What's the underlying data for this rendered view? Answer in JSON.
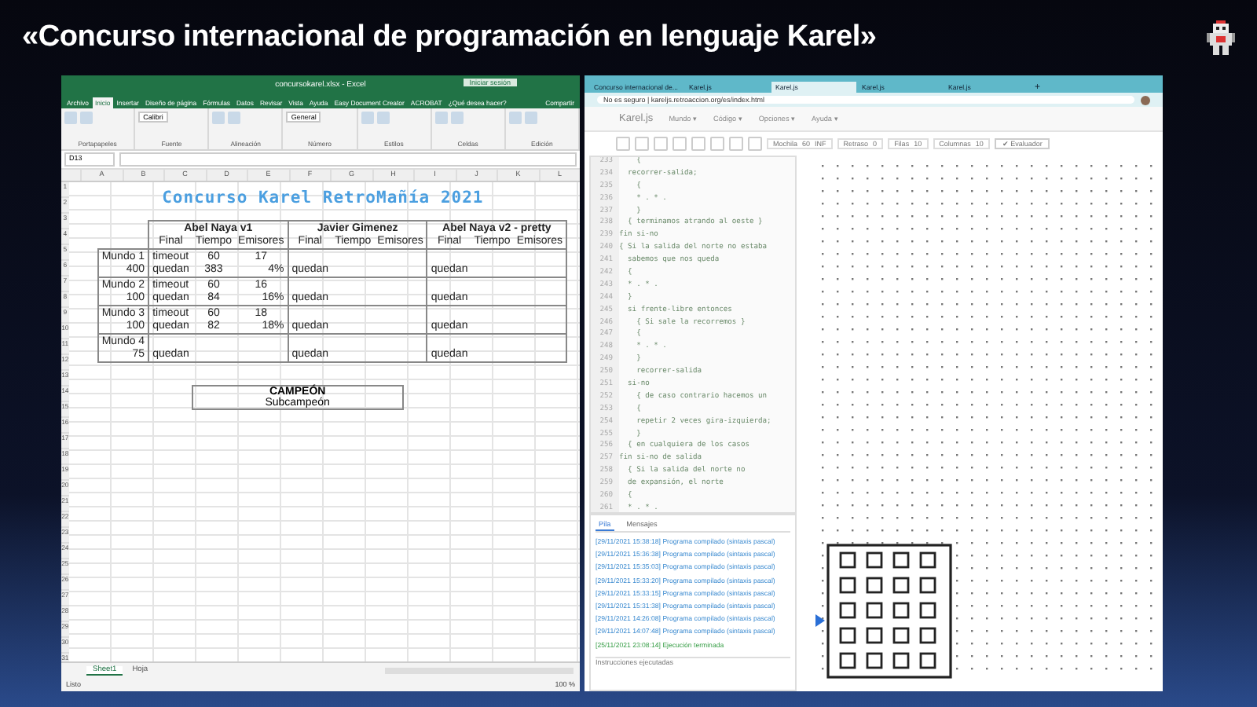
{
  "title": "«Concurso internacional de programación en lenguaje Karel»",
  "excel": {
    "window_title": "concursokarel.xlsx - Excel",
    "signin": "Iniciar sesión",
    "ribbon_tabs": [
      {
        "label": "Archivo",
        "selected": false
      },
      {
        "label": "Inicio",
        "selected": true
      },
      {
        "label": "Insertar",
        "selected": false
      },
      {
        "label": "Diseño de página",
        "selected": false
      },
      {
        "label": "Fórmulas",
        "selected": false
      },
      {
        "label": "Datos",
        "selected": false
      },
      {
        "label": "Revisar",
        "selected": false
      },
      {
        "label": "Vista",
        "selected": false
      },
      {
        "label": "Ayuda",
        "selected": false
      },
      {
        "label": "Easy Document Creator",
        "selected": false
      },
      {
        "label": "ACROBAT",
        "selected": false
      },
      {
        "label": "¿Qué desea hacer?",
        "selected": false
      }
    ],
    "share": "Compartir",
    "ribbon_groups": [
      "Portapapeles",
      "Fuente",
      "Alineación",
      "Número",
      "Estilos",
      "Celdas",
      "Edición"
    ],
    "font_name": "Calibri",
    "number_format": "General",
    "name_box": "D13",
    "columns": [
      "A",
      "B",
      "C",
      "D",
      "E",
      "F",
      "G",
      "H",
      "I",
      "J",
      "K",
      "L"
    ],
    "row_numbers": [
      "1",
      "2",
      "3",
      "4",
      "5",
      "6",
      "7",
      "8",
      "9",
      "10",
      "11",
      "12",
      "13",
      "14",
      "15",
      "16",
      "17",
      "18",
      "19",
      "20",
      "21",
      "22",
      "23",
      "24",
      "25",
      "26",
      "27",
      "28",
      "29",
      "30",
      "31"
    ],
    "sheet_title": "Concurso Karel  RetroMañía 2021",
    "players": [
      {
        "name": "Abel Naya v1",
        "subheaders": [
          "Final",
          "Tiempo",
          "Emisores"
        ]
      },
      {
        "name": "Javier Gimenez",
        "subheaders": [
          "Final",
          "Tiempo",
          "Emisores"
        ]
      },
      {
        "name": "Abel Naya v2 - pretty",
        "subheaders": [
          "Final",
          "Tiempo",
          "Emisores"
        ]
      }
    ],
    "worlds": [
      {
        "name": "Mundo 1",
        "score": "400",
        "results": [
          {
            "row_1": [
              "timeout",
              "60",
              "17"
            ],
            "row_2": [
              "quedan",
              "383",
              "4%"
            ]
          },
          {
            "row_2": [
              "quedan"
            ]
          },
          {
            "row_2": [
              "quedan"
            ]
          }
        ]
      },
      {
        "name": "Mundo 2",
        "score": "100",
        "results": [
          {
            "row_1": [
              "timeout",
              "60",
              "16"
            ],
            "row_2": [
              "quedan",
              "84",
              "16%"
            ]
          },
          {
            "row_2": [
              "quedan"
            ]
          },
          {
            "row_2": [
              "quedan"
            ]
          }
        ]
      },
      {
        "name": "Mundo 3",
        "score": "100",
        "results": [
          {
            "row_1": [
              "timeout",
              "60",
              "18"
            ],
            "row_2": [
              "quedan",
              "82",
              "18%"
            ]
          },
          {
            "row_2": [
              "quedan"
            ]
          },
          {
            "row_2": [
              "quedan"
            ]
          }
        ]
      },
      {
        "name": "Mundo 4",
        "score": "75",
        "results": [
          {
            "row_2": [
              "quedan"
            ]
          },
          {
            "row_2": [
              "quedan"
            ]
          },
          {
            "row_2": [
              "quedan"
            ]
          }
        ]
      }
    ],
    "podium": [
      "CAMPEÓN",
      "Subcampeón"
    ],
    "sheet_tabs": [
      {
        "label": "Sheet1",
        "selected": true
      },
      {
        "label": "Hoja",
        "selected": false
      }
    ],
    "status": "Listo",
    "zoom": "100 %"
  },
  "browser": {
    "tabs": [
      {
        "label": "Concurso internacional de...",
        "selected": false
      },
      {
        "label": "Karel.js",
        "selected": false
      },
      {
        "label": "Karel.js",
        "selected": true
      },
      {
        "label": "Karel.js",
        "selected": false
      },
      {
        "label": "Karel.js",
        "selected": false
      }
    ],
    "new_tab": "+",
    "url": "No es seguro | kareljs.retroaccion.org/es/index.html",
    "brand": "Karel.js",
    "menus": [
      "Mundo ▾",
      "Código ▾",
      "Opciones ▾",
      "Ayuda ▾"
    ],
    "toolbar": {
      "mochila_label": "Mochila",
      "mochila": "60",
      "inf": "INF",
      "delay_label": "Retraso",
      "delay": "0",
      "rows_label": "Filas",
      "rows": "10",
      "cols_label": "Columnas",
      "cols": "10",
      "evaluate": "✔ Evaluador"
    },
    "code_lines": [
      {
        "num": "233",
        "text": "    {"
      },
      {
        "num": "234",
        "text": "  recorrer-salida;"
      },
      {
        "num": "235",
        "text": "    {"
      },
      {
        "num": "236",
        "text": "    * . * ."
      },
      {
        "num": "237",
        "text": "    }"
      },
      {
        "num": "238",
        "text": "  { terminamos atrando al oeste }"
      },
      {
        "num": "239",
        "text": "fin si-no"
      },
      {
        "num": "240",
        "text": "{ Si la salida del norte no estaba"
      },
      {
        "num": "241",
        "text": "  sabemos que nos queda"
      },
      {
        "num": "242",
        "text": "  {"
      },
      {
        "num": "243",
        "text": "  * . * ."
      },
      {
        "num": "244",
        "text": "  }"
      },
      {
        "num": "245",
        "text": "  si frente-libre entonces"
      },
      {
        "num": "246",
        "text": "    { Si sale la recorremos }"
      },
      {
        "num": "247",
        "text": "    {"
      },
      {
        "num": "248",
        "text": "    * . * ."
      },
      {
        "num": "249",
        "text": "    }"
      },
      {
        "num": "250",
        "text": "    recorrer-salida"
      },
      {
        "num": "251",
        "text": "  si-no"
      },
      {
        "num": "252",
        "text": "    { de caso contrario hacemos un"
      },
      {
        "num": "253",
        "text": "    {"
      },
      {
        "num": "254",
        "text": "    repetir 2 veces gira-izquierda;"
      },
      {
        "num": "255",
        "text": "    }"
      },
      {
        "num": "256",
        "text": "  { en cualquiera de los casos"
      },
      {
        "num": "257",
        "text": "fin si-no de salida"
      },
      {
        "num": "258",
        "text": "  { Si la salida del norte no"
      },
      {
        "num": "259",
        "text": "  de expansión, el norte"
      },
      {
        "num": "260",
        "text": "  {"
      },
      {
        "num": "261",
        "text": "  * . * ."
      }
    ],
    "log_tabs": [
      {
        "label": "Pila",
        "selected": true
      },
      {
        "label": "Mensajes",
        "selected": false
      }
    ],
    "log": [
      {
        "kind": "info",
        "time": "[29/11/2021 15:38:18]",
        "text": "Programa compilado (sintaxis pascal)"
      },
      {
        "kind": "info",
        "time": "[29/11/2021 15:36:38]",
        "text": "Programa compilado (sintaxis pascal)"
      },
      {
        "kind": "info",
        "time": "[29/11/2021 15:35:03]",
        "text": "Programa compilado (sintaxis pascal)"
      },
      {
        "kind": "info",
        "time": "[29/11/2021 15:33:20]",
        "text": "Programa compilado (sintaxis pascal)"
      },
      {
        "kind": "info",
        "time": "[29/11/2021 15:33:15]",
        "text": "Programa compilado (sintaxis pascal)"
      },
      {
        "kind": "info",
        "time": "[29/11/2021 15:31:38]",
        "text": "Programa compilado (sintaxis pascal)"
      },
      {
        "kind": "info",
        "time": "[29/11/2021 14:26:08]",
        "text": "Programa compilado (sintaxis pascal)"
      },
      {
        "kind": "info",
        "time": "[29/11/2021 14:07:48]",
        "text": "Programa compilado (sintaxis pascal)"
      },
      {
        "kind": "success",
        "time": "[25/11/2021 23:08:14]",
        "text": "Ejecución terminada"
      }
    ],
    "footer": "Instrucciones ejecutadas"
  }
}
